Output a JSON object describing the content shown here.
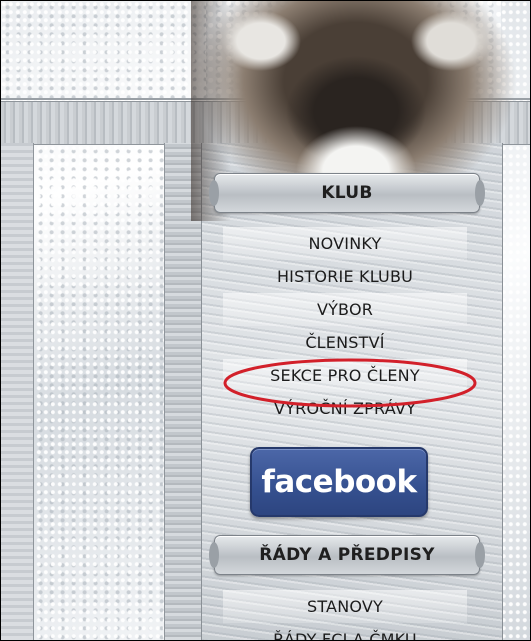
{
  "menu": {
    "klub_heading": "KLUB",
    "klub_items": [
      {
        "label": "NOVINKY"
      },
      {
        "label": "HISTORIE KLUBU"
      },
      {
        "label": "VÝBOR"
      },
      {
        "label": "ČLENSTVÍ"
      },
      {
        "label": "SEKCE PRO ČLENY"
      },
      {
        "label": "VÝROČNÍ ZPRÁVY"
      }
    ],
    "rady_heading": "ŘÁDY A PŘEDPISY",
    "rady_items": [
      {
        "label": "STANOVY"
      },
      {
        "label": "ŘÁDY FCI A ČMKU"
      }
    ]
  },
  "facebook": {
    "label": "facebook"
  },
  "highlight": {
    "color": "#d2202a",
    "target": "SEKCE PRO ČLENY"
  }
}
